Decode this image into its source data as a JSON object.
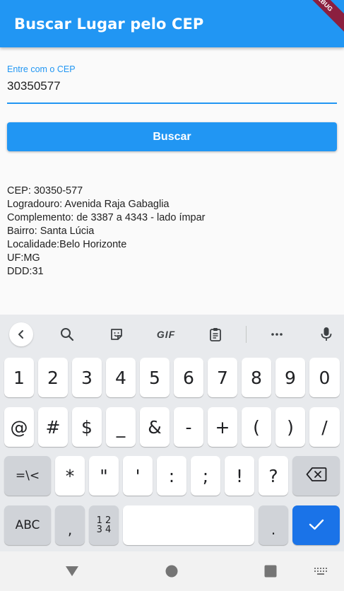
{
  "app": {
    "title": "Buscar Lugar pelo CEP",
    "debug_banner": "DEBUG"
  },
  "form": {
    "label": "Entre com o CEP",
    "value": "30350577",
    "button_label": "Buscar"
  },
  "result": {
    "cep": "CEP: 30350-577",
    "logradouro": "Logradouro: Avenida Raja Gabaglia",
    "complemento": "Complemento: de 3387 a 4343 - lado ímpar",
    "bairro": "Bairro: Santa Lúcia",
    "localidade": "Localidade:Belo Horizonte",
    "uf": "UF:MG",
    "ddd": "DDD:31"
  },
  "keyboard": {
    "toolbar": {
      "gif": "GIF"
    },
    "row1": [
      "1",
      "2",
      "3",
      "4",
      "5",
      "6",
      "7",
      "8",
      "9",
      "0"
    ],
    "row2": [
      "@",
      "#",
      "$",
      "_",
      "&",
      "-",
      "+",
      "(",
      ")",
      "/"
    ],
    "row3": [
      "=\\<",
      "*",
      "\"",
      "'",
      ":",
      ";",
      "!",
      "?"
    ],
    "row4": {
      "abc": "ABC",
      "comma": ",",
      "numpad_top": "1 2",
      "numpad_bottom": "3 4",
      "period": "."
    }
  },
  "colors": {
    "primary": "#2196f3",
    "enter_key": "#1a73e8",
    "keyboard_bg": "#e8eaed"
  }
}
